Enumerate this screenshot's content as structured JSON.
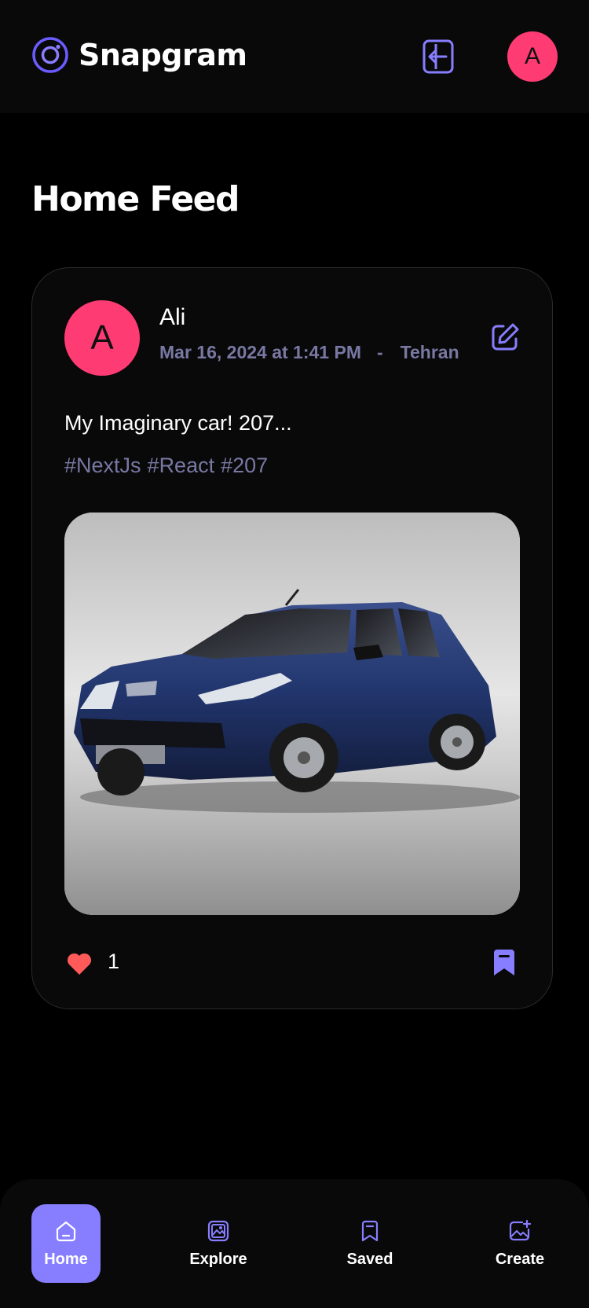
{
  "app": {
    "name": "Snapgram",
    "brand_color": "#877eff",
    "avatar_color": "#ff3b73"
  },
  "header": {
    "avatar_initial": "A",
    "logout_icon": "logout-icon"
  },
  "page": {
    "title": "Home Feed"
  },
  "post": {
    "author_initial": "A",
    "author": "Ali",
    "date": "Mar 16, 2024 at 1:41 PM",
    "separator": "-",
    "location": "Tehran",
    "caption": "My Imaginary car! 207...",
    "tags": [
      "#NextJs",
      "#React",
      "#207"
    ],
    "image_alt": "Blue Peugeot 207 hatchback",
    "likes": "1",
    "liked": true,
    "saved": true
  },
  "bottom_nav": {
    "items": [
      {
        "label": "Home",
        "icon": "home-icon",
        "active": true
      },
      {
        "label": "Explore",
        "icon": "explore-icon",
        "active": false
      },
      {
        "label": "Saved",
        "icon": "bookmark-icon",
        "active": false
      },
      {
        "label": "Create",
        "icon": "create-post-icon",
        "active": false
      }
    ]
  }
}
